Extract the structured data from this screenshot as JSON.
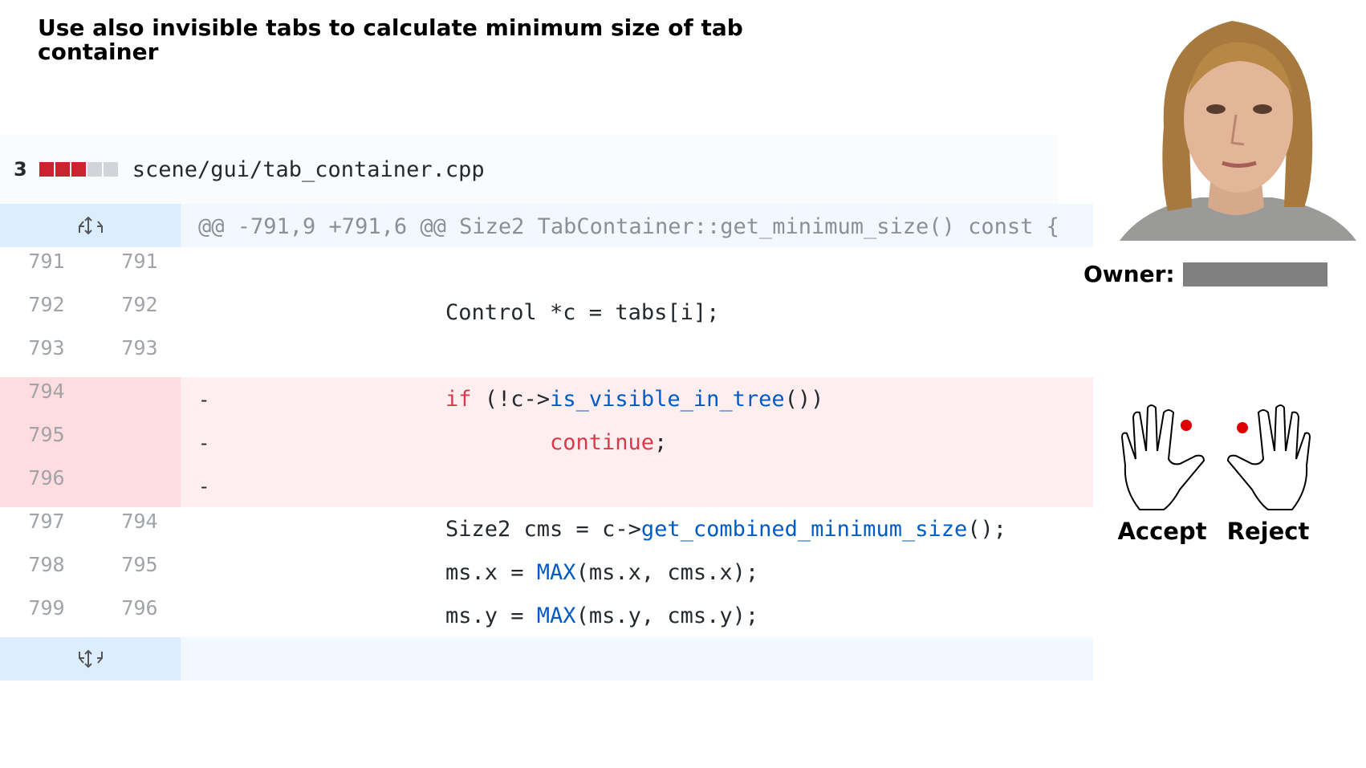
{
  "title": "Use also invisible tabs to calculate minimum size of tab container",
  "file": {
    "changes": "3",
    "stat_colors": [
      "#cb2431",
      "#cb2431",
      "#cb2431",
      "#d1d5da",
      "#d1d5da"
    ],
    "path": "scene/gui/tab_container.cpp"
  },
  "hunk": "@@ -791,9 +791,6 @@ Size2 TabContainer::get_minimum_size() const {",
  "lines": [
    {
      "old": "791",
      "new": "791",
      "marker": "",
      "code": ""
    },
    {
      "old": "792",
      "new": "792",
      "marker": "",
      "code": "Control *c = tabs[i];"
    },
    {
      "old": "793",
      "new": "793",
      "marker": "",
      "code": ""
    },
    {
      "old": "794",
      "new": "",
      "marker": "-",
      "code_kw": "if",
      "code_rest_a": " (!c->",
      "code_fn": "is_visible_in_tree",
      "code_rest_b": "())"
    },
    {
      "old": "795",
      "new": "",
      "marker": "-",
      "code": "continue",
      "code_tail": ";"
    },
    {
      "old": "796",
      "new": "",
      "marker": "-",
      "code": ""
    },
    {
      "old": "797",
      "new": "794",
      "marker": "",
      "code_a": "Size2 cms = c->",
      "code_fn": "get_combined_minimum_size",
      "code_b": "();"
    },
    {
      "old": "798",
      "new": "795",
      "marker": "",
      "code_a": "ms.x = ",
      "code_fn": "MAX",
      "code_b": "(ms.x, cms.x);"
    },
    {
      "old": "799",
      "new": "796",
      "marker": "",
      "code_a": "ms.y = ",
      "code_fn": "MAX",
      "code_b": "(ms.y, cms.y);"
    }
  ],
  "owner_label": "Owner:",
  "accept_label": "Accept",
  "reject_label": "Reject",
  "icons": {
    "expand_up": "expand-up-icon",
    "expand_down": "expand-down-icon",
    "hand_left": "left-hand-icon",
    "hand_right": "right-hand-icon"
  }
}
